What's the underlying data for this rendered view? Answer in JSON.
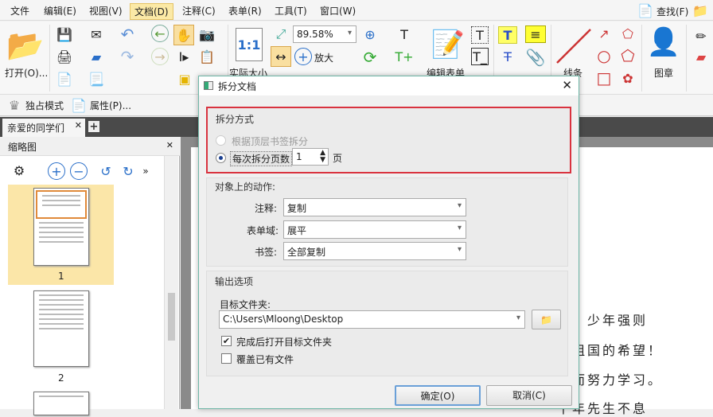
{
  "menu": [
    "文件",
    "编辑(E)",
    "视图(V)",
    "文档(D)",
    "注释(C)",
    "表单(R)",
    "工具(T)",
    "窗口(W)"
  ],
  "search_label": "查找(F)",
  "toolbar": {
    "open": "打开(O)...",
    "zoom_value": "89.58%",
    "actual_size": "实际大小",
    "zoom_in": "放大",
    "edit_form": "编辑表单",
    "line": "线条",
    "stamp": "图章"
  },
  "row2": {
    "exclusive": "独占模式",
    "properties": "属性(P)..."
  },
  "doc_tab": "亲爱的同学们",
  "left_panel": {
    "title": "缩略图",
    "pages": [
      "1",
      "2"
    ]
  },
  "page_text": [
    "智，少年强则",
    "是祖国的希望！",
    "盛而努力学习。",
    "千年先生不息"
  ],
  "dialog": {
    "title": "拆分文档",
    "split_group": "拆分方式",
    "opt_bookmark": "根据顶层书签拆分",
    "opt_pages": "每次拆分页数",
    "pages_value": "1",
    "pages_unit": "页",
    "actions_group": "对象上的动作:",
    "annot_label": "注释:",
    "annot_value": "复制",
    "form_label": "表单域:",
    "form_value": "展平",
    "bm_label": "书签:",
    "bm_value": "全部复制",
    "output_group": "输出选项",
    "folder_label": "目标文件夹:",
    "folder_value": "C:\\Users\\Mloong\\Desktop",
    "open_after": "完成后打开目标文件夹",
    "overwrite": "覆盖已有文件",
    "ok": "确定(O)",
    "cancel": "取消(C)"
  }
}
